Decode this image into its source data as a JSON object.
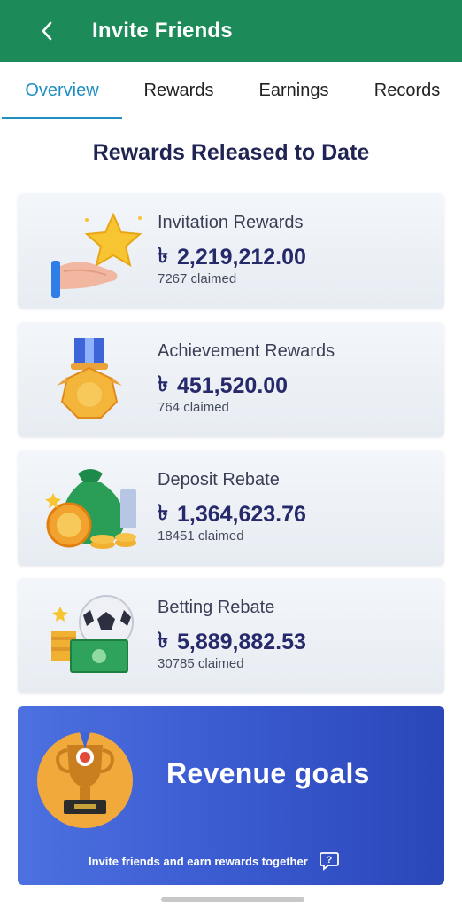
{
  "header": {
    "title": "Invite Friends"
  },
  "tabs": [
    {
      "label": "Overview",
      "active": true
    },
    {
      "label": "Rewards",
      "active": false
    },
    {
      "label": "Earnings",
      "active": false
    },
    {
      "label": "Records",
      "active": false
    }
  ],
  "section": {
    "title": "Rewards Released to Date"
  },
  "currency_symbol": "৳",
  "cards": [
    {
      "label": "Invitation Rewards",
      "amount": "2,219,212.00",
      "claimed": "7267 claimed",
      "icon": "star-hand-icon"
    },
    {
      "label": "Achievement Rewards",
      "amount": "451,520.00",
      "claimed": "764 claimed",
      "icon": "medal-icon"
    },
    {
      "label": "Deposit Rebate",
      "amount": "1,364,623.76",
      "claimed": "18451 claimed",
      "icon": "money-bag-icon"
    },
    {
      "label": "Betting Rebate",
      "amount": "5,889,882.53",
      "claimed": "30785 claimed",
      "icon": "ball-cash-icon"
    }
  ],
  "banner": {
    "title": "Revenue goals",
    "subtitle": "Invite friends and earn rewards together",
    "icon": "trophy-icon"
  },
  "colors": {
    "header": "#1d8a5a",
    "tab_active": "#1f8fc0",
    "amount": "#262a6b",
    "banner": "#3a5ad0"
  }
}
